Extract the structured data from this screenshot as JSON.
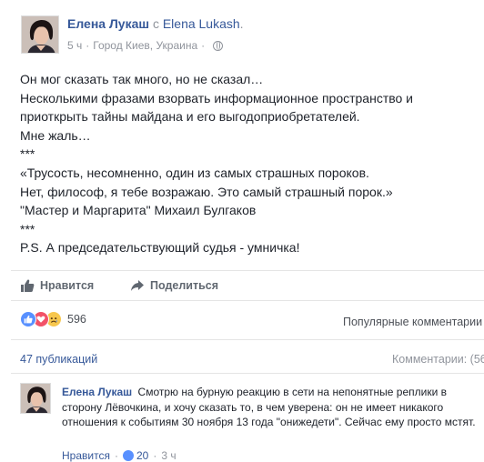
{
  "post": {
    "author": "Елена Лукаш",
    "with_word": "с",
    "tagged": "Elena Lukash",
    "tagged_suffix": ".",
    "time": "5 ч",
    "separator": "·",
    "location": "Город Киев, Украина",
    "lines": [
      "Он мог сказать так много, но не сказал…",
      "Несколькими фразами взорвать информационное пространство и",
      "приоткрыть тайны майдана и его выгодоприобретателей.",
      "Мне жаль…",
      "***",
      "«Трусость, несомненно, один из самых страшных пороков.",
      "Нет, философ, я тебе возражаю. Это самый страшный порок.»",
      "\"Мастер и Маргарита\" Михаил Булгаков",
      "***",
      "P.S. А председательствующий судья - умничка!"
    ]
  },
  "actions": {
    "like_label": "Нравится",
    "share_label": "Поделиться"
  },
  "reactions": {
    "count": "596",
    "top_comments_label": "Популярные комментарии"
  },
  "stats": {
    "shares": "47 публикаций",
    "comments": "Комментарии: (56"
  },
  "comment": {
    "author": "Елена Лукаш",
    "text": "Смотрю на бурную реакцию в сети на непонятные реплики в сторону Лёвочкина, и хочу сказать то, в чем уверена: он не имеет никакого отношения к событиям 30 ноября 13 года \"онижедети\". Сейчас ему просто мстят.",
    "like_label": "Нравится",
    "separator": "·",
    "likes": "20",
    "time": "3 ч"
  },
  "colors": {
    "link": "#365899",
    "muted": "#90949c",
    "like_blue": "#5890ff",
    "love_red": "#f25268",
    "sad_yellow": "#f7c74e"
  }
}
